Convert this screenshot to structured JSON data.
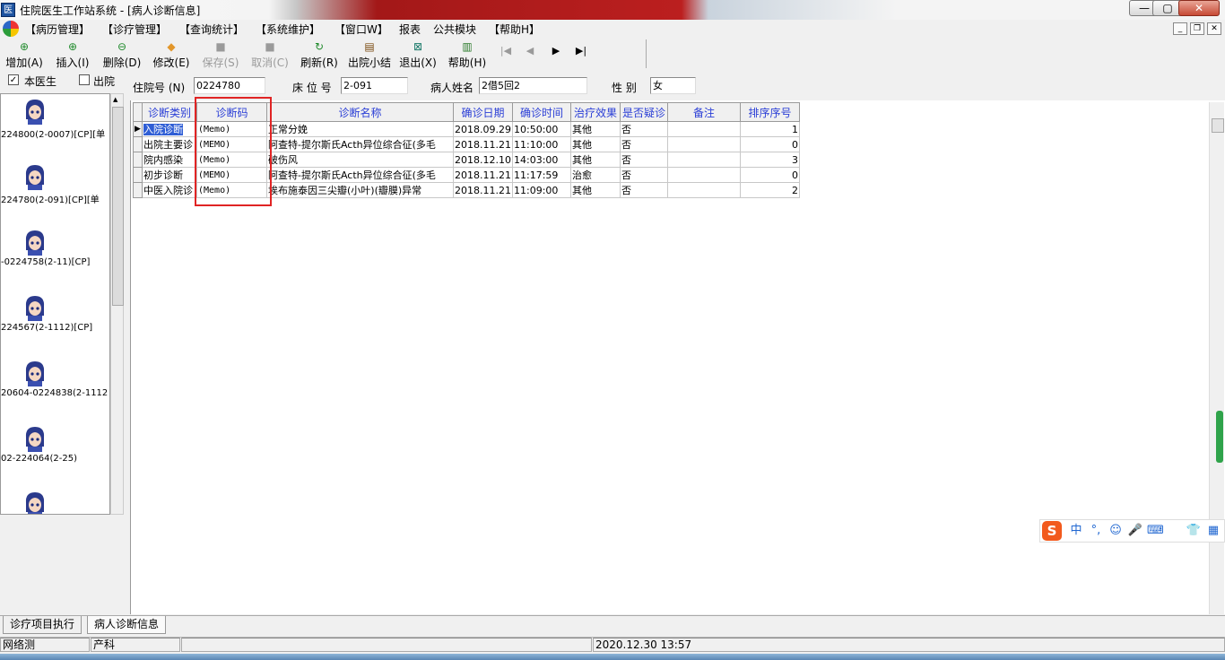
{
  "window": {
    "title": "住院医生工作站系统 - [病人诊断信息]",
    "icon_text": "医",
    "controls": {
      "minimize": "—",
      "maximize": "▢",
      "close": "✕"
    }
  },
  "menu": {
    "items": [
      "【病历管理】",
      "【诊疗管理】",
      "【查询统计】",
      "【系统维护】",
      "【窗口W】",
      "报表",
      "公共模块",
      "【帮助H】"
    ],
    "mdi_controls": {
      "minimize": "_",
      "restore": "❐",
      "close": "✕"
    }
  },
  "toolbar": {
    "buttons": [
      {
        "label": "增加(A)",
        "icon": "plus-circle-icon",
        "glyph": "⊕",
        "color": "#1f8a2b"
      },
      {
        "label": "插入(I)",
        "icon": "insert-circle-icon",
        "glyph": "⊕",
        "color": "#1f8a2b"
      },
      {
        "label": "删除(D)",
        "icon": "minus-circle-icon",
        "glyph": "⊖",
        "color": "#1f8a2b"
      },
      {
        "label": "修改(E)",
        "icon": "eraser-icon",
        "glyph": "◆",
        "color": "#e2962a"
      },
      {
        "label": "保存(S)",
        "icon": "save-icon",
        "glyph": "■",
        "color": "#9a9a9a"
      },
      {
        "label": "取消(C)",
        "icon": "cancel-icon",
        "glyph": "■",
        "color": "#9a9a9a"
      },
      {
        "label": "刷新(R)",
        "icon": "refresh-icon",
        "glyph": "↻",
        "color": "#1f8a2b"
      },
      {
        "label": "出院小结",
        "icon": "book-icon",
        "glyph": "▤",
        "color": "#7a4a10"
      },
      {
        "label": "退出(X)",
        "icon": "exit-icon",
        "glyph": "⊠",
        "color": "#1a7a6a"
      },
      {
        "label": "帮助(H)",
        "icon": "help-book-icon",
        "glyph": "▥",
        "color": "#2a7a2a"
      }
    ],
    "nav": [
      "|◀",
      "◀",
      "▶",
      "▶|"
    ]
  },
  "filters": {
    "own_doctor": "本医生",
    "own_doctor_checked": true,
    "discharged": "出院",
    "discharged_checked": false
  },
  "patients": [
    {
      "label": "224800(2-0007)[CP][单"
    },
    {
      "label": "224780(2-091)[CP][单"
    },
    {
      "label": "-0224758(2-11)[CP]"
    },
    {
      "label": "224567(2-1112)[CP]"
    },
    {
      "label": "20604-0224838(2-1112"
    },
    {
      "label": "02-224064(2-25)"
    },
    {
      "label": ""
    }
  ],
  "header_fields": {
    "admission_no_label": "住院号 (N)",
    "admission_no": "0224780",
    "bed_label": "床 位 号",
    "bed": "2-091",
    "name_label": "病人姓名",
    "name": "2借5回2",
    "gender_label": "性  别",
    "gender": "女"
  },
  "grid": {
    "columns": [
      "诊断类别",
      "诊断码",
      "诊断名称",
      "确诊日期",
      "确诊时间",
      "治疗效果",
      "是否疑诊",
      "备注",
      "排序序号"
    ],
    "rows": [
      [
        "入院诊断",
        "(Memo)",
        "正常分娩",
        "2018.09.29",
        "10:50:00",
        "其他",
        "否",
        "",
        "1"
      ],
      [
        "出院主要诊",
        "(MEMO)",
        "阿查特-提尔斯氏Acth异位综合征(多毛",
        "2018.11.21",
        "11:10:00",
        "其他",
        "否",
        "",
        "0"
      ],
      [
        "院内感染",
        "(Memo)",
        "破伤风",
        "2018.12.10",
        "14:03:00",
        "其他",
        "否",
        "",
        "3"
      ],
      [
        "初步诊断",
        "(MEMO)",
        "阿查特-提尔斯氏Acth异位综合征(多毛",
        "2018.11.21",
        "11:17:59",
        "治愈",
        "否",
        "",
        "0"
      ],
      [
        "中医入院诊",
        "(Memo)",
        "埃布施泰因三尖瓣(小叶)(瓣膜)异常",
        "2018.11.21",
        "11:09:00",
        "其他",
        "否",
        "",
        "2"
      ]
    ],
    "current_row_indicator": "▶"
  },
  "ime": {
    "logo": "S",
    "items": [
      "中",
      "°,",
      "☺",
      "🎤",
      "⌨",
      "👕",
      "▦"
    ]
  },
  "tabs": [
    "诊疗项目执行",
    "病人诊断信息"
  ],
  "status": {
    "mode": "网络测",
    "dept": "产科",
    "blank": "",
    "datetime": "2020.12.30 13:57"
  }
}
